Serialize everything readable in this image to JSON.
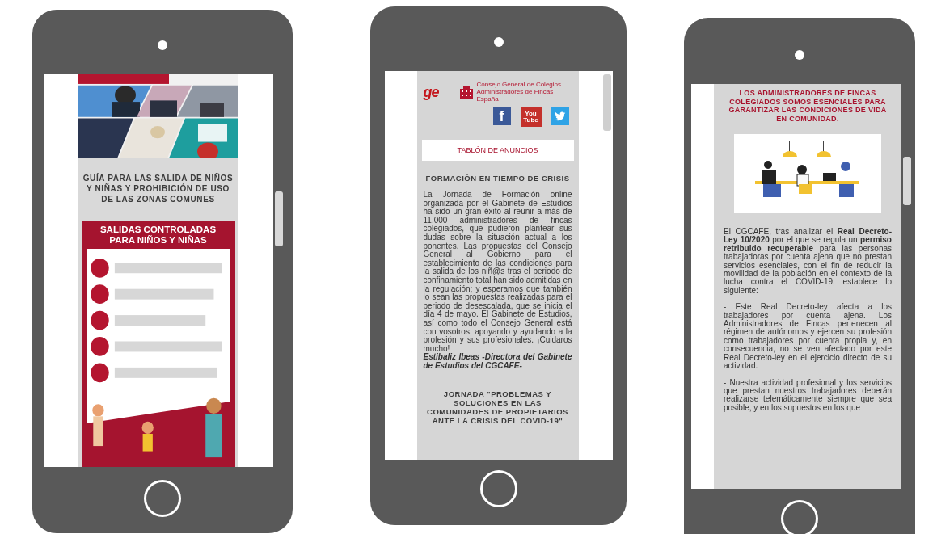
{
  "phones": [
    {
      "blocks": [
        {
          "kind": "picture"
        },
        {
          "kind": "heading",
          "text": "GUÍA PARA LAS SALIDA DE NIÑOS Y NIÑAS Y PROHIBICIÓN DE USO DE LAS ZONAS COMUNES"
        },
        {
          "kind": "infographic",
          "text": "SALIDAS CONTROLADAS PARA NIÑOS Y NIÑAS"
        }
      ]
    },
    {
      "blocks": [
        {
          "kind": "logos",
          "mark": "ge",
          "org": "Consejo General de Colegios Administradores de Fincas España"
        },
        {
          "kind": "social",
          "items": [
            {
              "kind": "facebook",
              "glyph": "f"
            },
            {
              "kind": "youtube",
              "glyph": "You Tube"
            },
            {
              "kind": "twitter"
            }
          ]
        },
        {
          "kind": "notice",
          "text": "TABLÓN DE ANUNCIOS"
        },
        {
          "kind": "heading",
          "text": "FORMACIÓN EN TIEMPO DE CRISIS"
        },
        {
          "kind": "paragraph",
          "text": "La Jornada de Formación online organizada por el Gabinete de Estudios ha sido un gran éxito al reunir a más de 11.000 administradores de fincas colegiados, que pudieron plantear sus dudas sobre la situación actual a los ponentes. Las propuestas del Consejo General al Gobierno para el establecimiento de las condiciones para la salida de los niñ@s tras el periodo de confinamiento total han sido admitidas en la regulación; y esperamos que también lo sean las propuestas realizadas para el periodo de desescalada, que se inicia el día 4 de mayo. El Gabinete de Estudios, así como todo el Consejo General está con vosotros, apoyando y ayudando a la profesión y sus profesionales. ¡Cuidaros mucho!"
        },
        {
          "kind": "signature",
          "text": "Estibaliz Ibeas -Directora del Gabinete de Estudios del CGCAFE-"
        },
        {
          "kind": "heading",
          "text": "JORNADA \"PROBLEMAS Y SOLUCIONES EN LAS COMUNIDADES DE PROPIETARIOS ANTE LA CRISIS DEL COVID-19\""
        }
      ]
    },
    {
      "blocks": [
        {
          "kind": "alert",
          "text": "LOS ADMINISTRADORES DE FINCAS COLEGIADOS SOMOS ESENCIALES PARA GARANTIZAR LAS CONDICIONES DE VIDA EN COMUNIDAD."
        },
        {
          "kind": "illustration"
        },
        {
          "kind": "paragraph",
          "text": "El CGCAFE, tras analizar el **Real Decreto-Ley 10/2020** por el que se regula un **permiso retribuido recuperable** para las personas trabajadoras por cuenta ajena que no prestan servicios esenciales, con el fin de reducir la movilidad de la población en el contexto de la lucha contra el COVID-19, establece lo siguiente:"
        },
        {
          "kind": "paragraph",
          "text": "- Este Real Decreto-ley afecta a los trabajadores por cuenta ajena. Los Administradores de Fincas pertenecen al régimen de autónomos y ejercen su profesión como trabajadores por cuenta propia y, en consecuencia, no se ven afectado por este Real Decreto-ley en el ejercicio directo de su actividad."
        },
        {
          "kind": "paragraph",
          "text": "- Nuestra actividad profesional y los servicios que prestan nuestros trabajadores deberán realizarse telemáticamente siempre que sea posible, y en los supuestos en los que"
        }
      ]
    }
  ]
}
